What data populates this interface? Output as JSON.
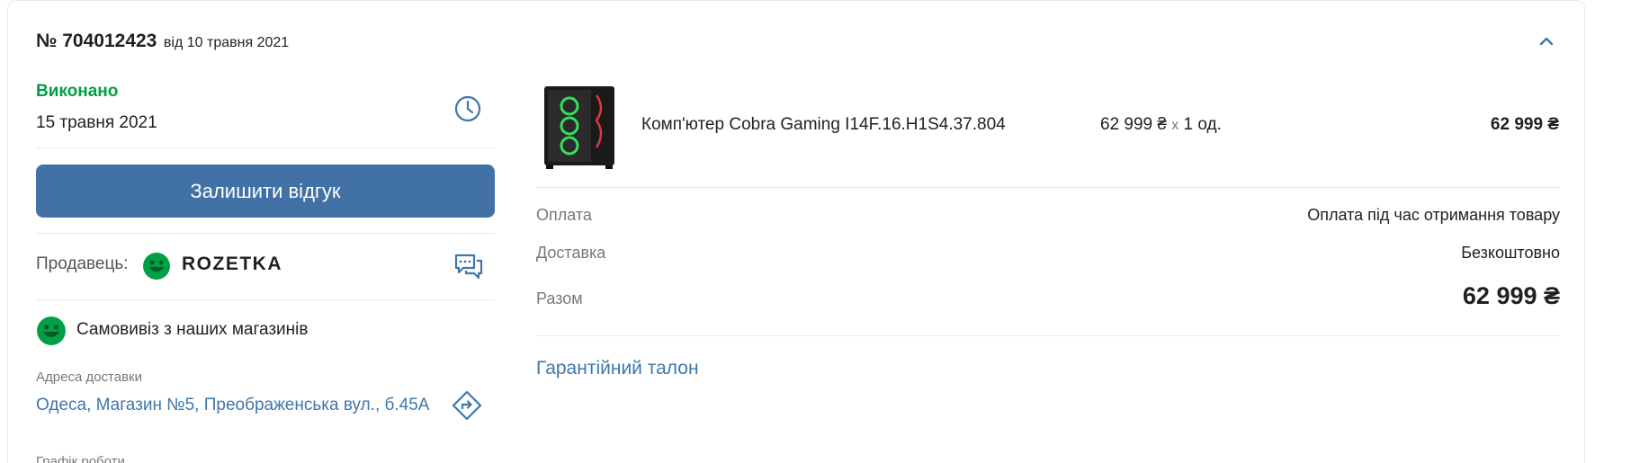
{
  "order": {
    "number": "№ 704012423",
    "date": "від 10 травня 2021"
  },
  "status": {
    "label": "Виконано",
    "date": "15 травня 2021",
    "color": "#00a046"
  },
  "actions": {
    "review_label": "Залишити відгук",
    "accent": "#4271a6"
  },
  "seller": {
    "label": "Продавець:",
    "name": "ROZETKA"
  },
  "delivery": {
    "method": "Самовивіз з наших магазинів",
    "address_label": "Адреса доставки",
    "address": "Одеса, Магазин №5, Преображенська вул., б.45А",
    "schedule_label": "Графік роботи"
  },
  "product": {
    "name": "Комп'ютер Cobra Gaming I14F.16.H1S4.37.804",
    "unit_price": "62 999 ₴",
    "times": "x",
    "quantity": "1 од.",
    "total": "62 999 ₴"
  },
  "summary": {
    "payment_label": "Оплата",
    "payment_value": "Оплата під час отримання товару",
    "shipping_label": "Доставка",
    "shipping_value": "Безкоштовно",
    "total_label": "Разом",
    "total_value": "62 999 ₴"
  },
  "links": {
    "warranty": "Гарантійний талон"
  },
  "icons": {
    "collapse": "chevron-up-icon",
    "status": "clock-icon",
    "chat": "chat-icon",
    "route": "route-icon",
    "seller_logo": "rozetka-smile-icon"
  }
}
